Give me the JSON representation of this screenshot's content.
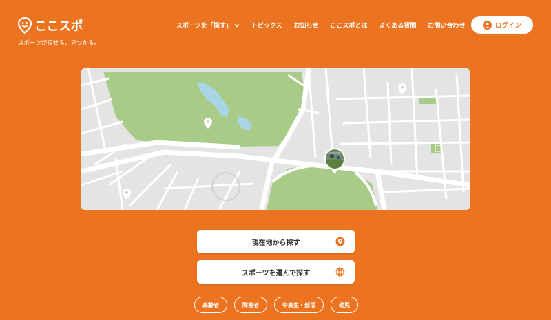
{
  "brand": {
    "name": "ここスポ",
    "tagline": "スポーツが探せる、見つかる。"
  },
  "nav": {
    "items": [
      {
        "label": "スポーツを「探す」",
        "dropdown": true
      },
      {
        "label": "トピックス"
      },
      {
        "label": "お知らせ"
      },
      {
        "label": "ここスポとは"
      },
      {
        "label": "よくある質問"
      },
      {
        "label": "お問い合わせ"
      }
    ],
    "login_label": "ログイン"
  },
  "actions": {
    "locate_label": "現在地から探す",
    "sports_label": "スポーツを選んで探す"
  },
  "tags": [
    "高齢者",
    "障害者",
    "中高生・部活",
    "幼児"
  ],
  "colors": {
    "accent": "#ec7420",
    "park": "#a8cb87",
    "water": "#a9d6e6",
    "road": "#ffffff",
    "block": "#e4e4e4"
  },
  "icons": {
    "logo": "location-pin-face-icon",
    "login": "user-icon",
    "locate": "location-pin-icon",
    "sports": "basketball-icon",
    "nav_dropdown": "chevron-down-icon"
  }
}
